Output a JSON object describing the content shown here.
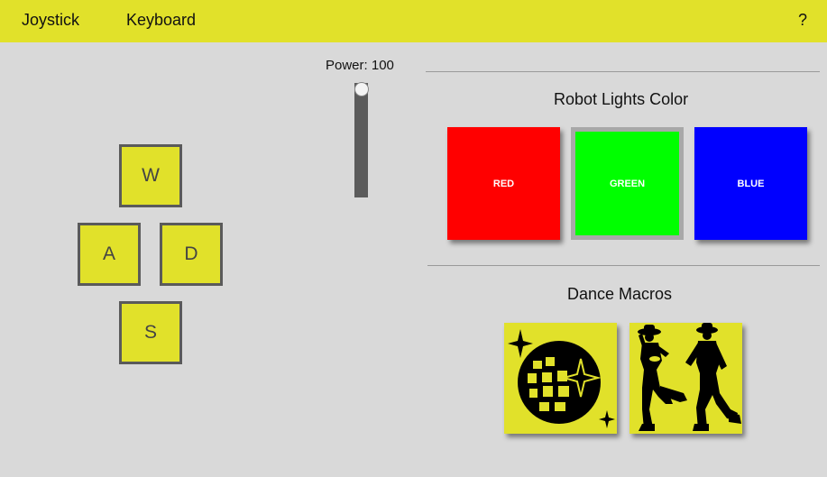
{
  "topbar": {
    "tabs": [
      "Joystick",
      "Keyboard"
    ],
    "help": "?"
  },
  "keys": {
    "w": "W",
    "a": "A",
    "d": "D",
    "s": "S"
  },
  "power": {
    "label": "Power: 100",
    "value": 100
  },
  "lights": {
    "title": "Robot Lights Color",
    "buttons": [
      {
        "label": "RED",
        "color": "#ff0000"
      },
      {
        "label": "GREEN",
        "color": "#00ff00",
        "selected": true
      },
      {
        "label": "BLUE",
        "color": "#0000ff"
      }
    ]
  },
  "dance": {
    "title": "Dance Macros",
    "macros": [
      {
        "icon": "disco-ball-icon"
      },
      {
        "icon": "cowboy-dancers-icon"
      }
    ]
  },
  "colors": {
    "accent": "#e1e12a",
    "background": "#d9d9d9",
    "key_border": "#5a5a5a"
  }
}
